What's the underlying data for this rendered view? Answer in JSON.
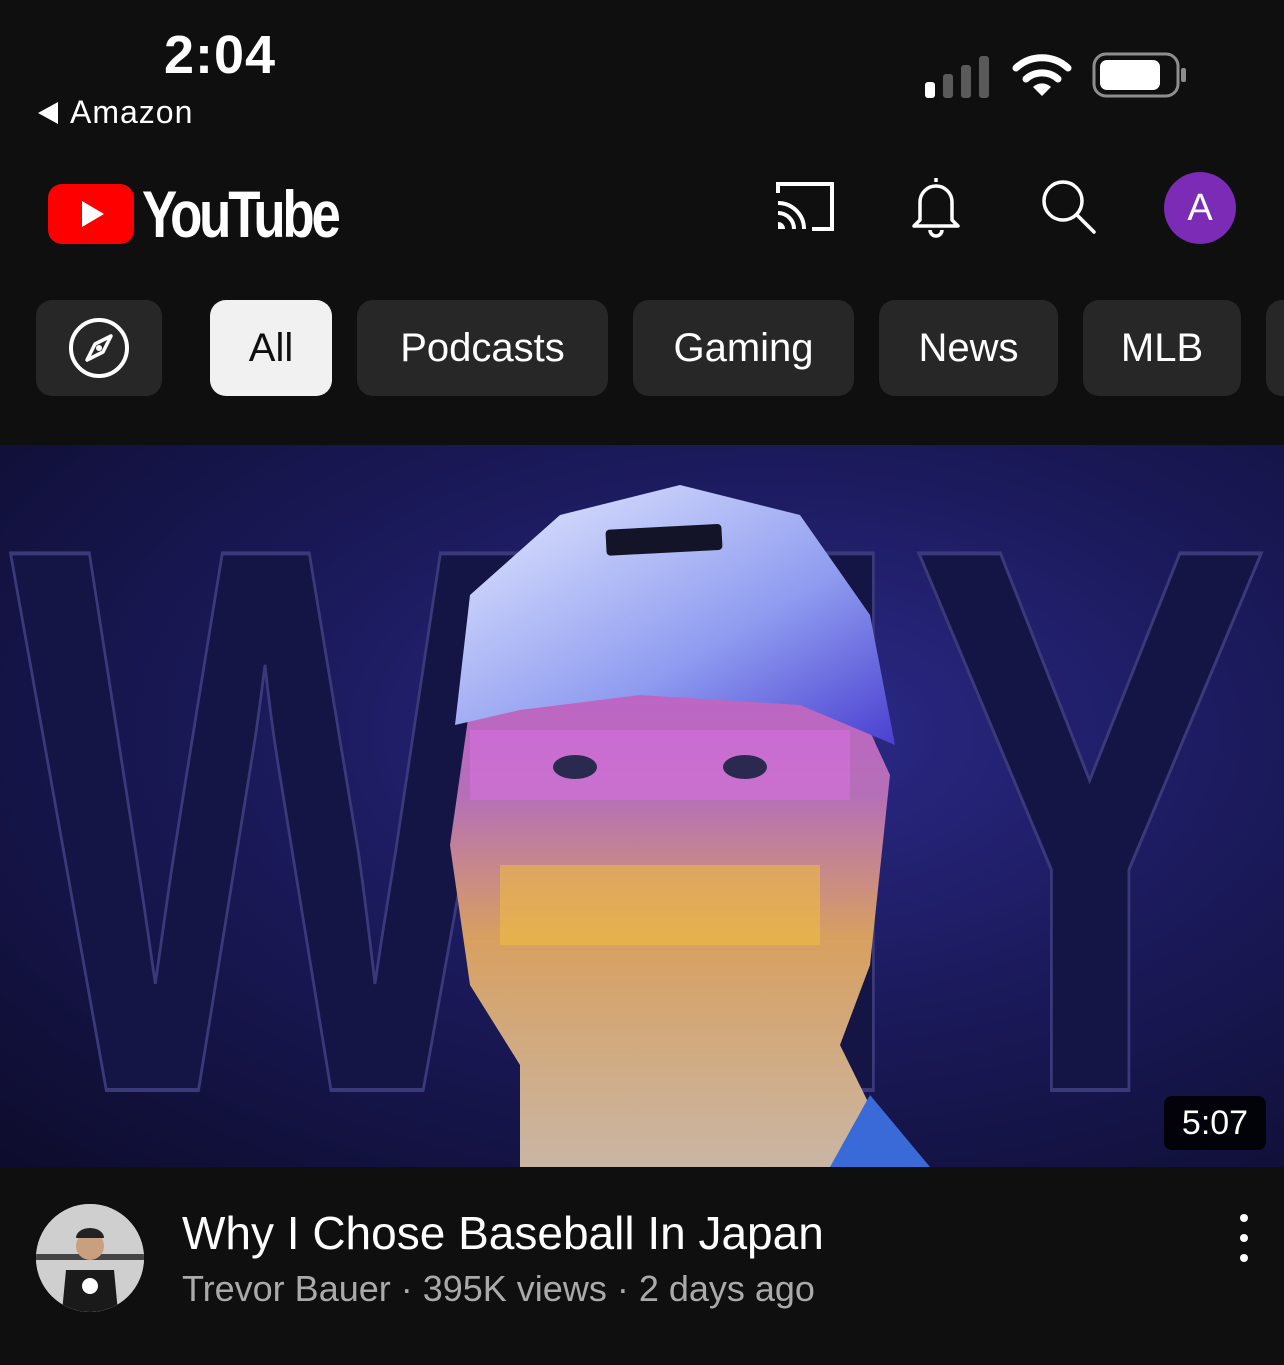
{
  "status_bar": {
    "time": "2:04",
    "back_app": "Amazon",
    "icons": [
      "cellular-signal-icon",
      "wifi-icon",
      "battery-icon"
    ]
  },
  "header": {
    "logo_text": "YouTube",
    "icons": [
      "cast-icon",
      "bell-icon",
      "search-icon"
    ],
    "avatar_letter": "A",
    "avatar_color": "#7b2bb5"
  },
  "chips": {
    "explore_icon": "compass-icon",
    "items": [
      {
        "label": "All",
        "active": true
      },
      {
        "label": "Podcasts",
        "active": false
      },
      {
        "label": "Gaming",
        "active": false
      },
      {
        "label": "News",
        "active": false
      },
      {
        "label": "MLB",
        "active": false
      }
    ]
  },
  "video": {
    "thumbnail_text": "WHY",
    "duration": "5:07",
    "title": "Why I Chose Baseball In Japan",
    "channel": "Trevor Bauer",
    "views": "395K views",
    "age": "2 days ago",
    "subtitle": "Trevor Bauer · 395K views · 2 days ago"
  },
  "colors": {
    "background": "#0f0f0f",
    "chip": "#272727",
    "chip_active": "#f1f1f1",
    "youtube_red": "#ff0000",
    "secondary_text": "#aaaaaa"
  }
}
